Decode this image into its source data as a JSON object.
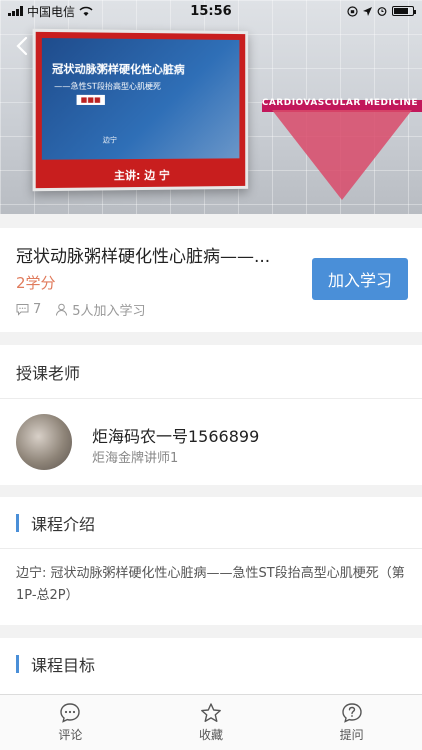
{
  "status_bar": {
    "carrier": "中国电信",
    "time": "15:56"
  },
  "banner": {
    "screen_title": "冠状动脉粥样硬化性心脏病",
    "screen_subtitle": "——急性ST段抬高型心肌梗死",
    "screen_presenter": "边宁",
    "screen_footer": "主讲: 边 宁",
    "stage_text": "CARDIOVASCULAR MEDICINE"
  },
  "course": {
    "title": "冠状动脉粥样硬化性心脏病——...",
    "credit": "2学分",
    "comments_count": "7",
    "joined_text": "5人加入学习",
    "join_button": "加入学习"
  },
  "teacher": {
    "section_title": "授课老师",
    "name": "炬海码农一号1566899",
    "title": "炬海金牌讲师1"
  },
  "intro": {
    "section_title": "课程介绍",
    "text": "边宁: 冠状动脉粥样硬化性心脏病——急性ST段抬高型心肌梗死（第1P-总2P）"
  },
  "goal": {
    "section_title": "课程目标"
  },
  "toolbar": {
    "comment_label": "评论",
    "favorite_label": "收藏",
    "ask_label": "提问"
  },
  "colors": {
    "accent": "#4a8fd8",
    "credit": "#e07b5c"
  }
}
